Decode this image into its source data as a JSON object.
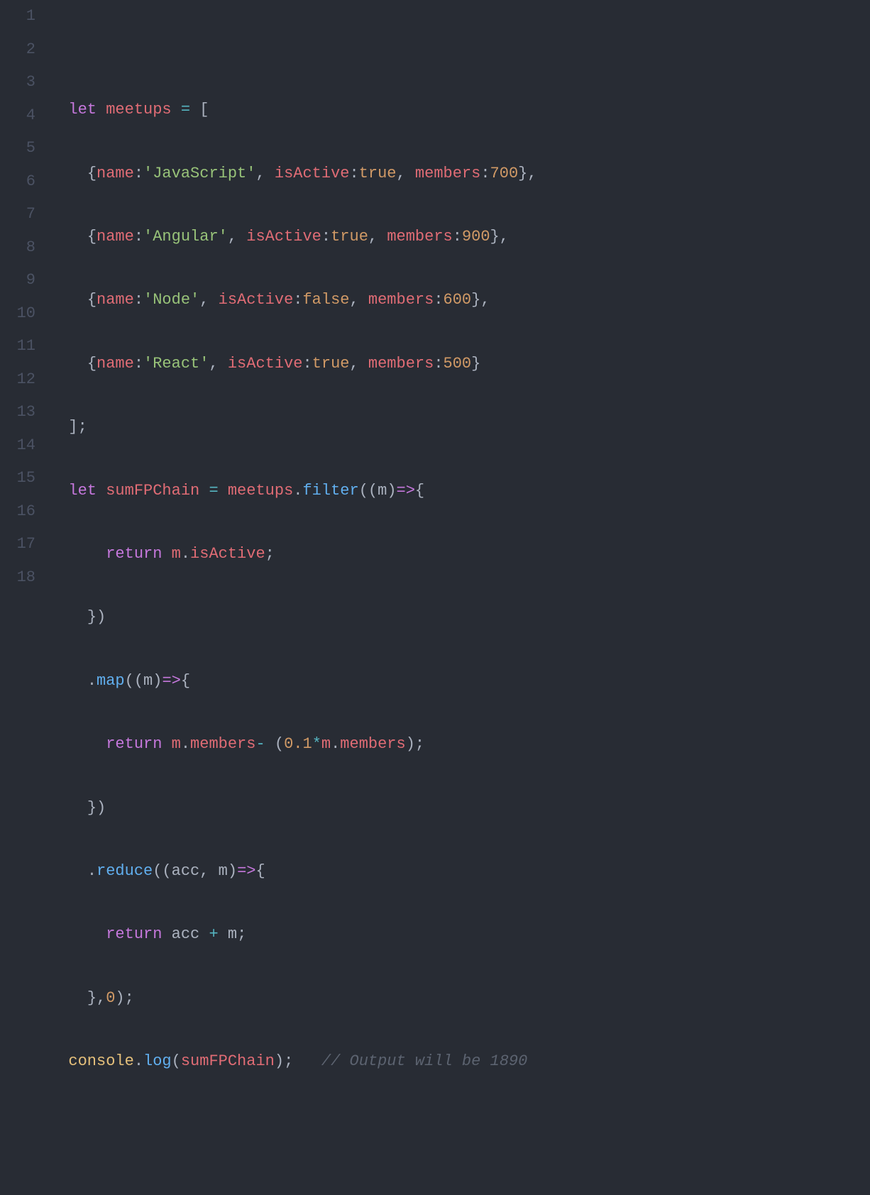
{
  "lineNumbers": [
    "1",
    "2",
    "3",
    "4",
    "5",
    "6",
    "7",
    "8",
    "9",
    "10",
    "11",
    "12",
    "13",
    "14",
    "15",
    "16",
    "17",
    "18"
  ],
  "code": {
    "line2": {
      "let": "let",
      "sp1": " ",
      "var": "meetups",
      "sp2": " ",
      "eq": "=",
      "sp3": " ",
      "br": "["
    },
    "line3": {
      "indent": "    ",
      "lb": "{",
      "name_k": "name",
      "colon1": ":",
      "name_v": "'JavaScript'",
      "comma1": ", ",
      "act_k": "isActive",
      "colon2": ":",
      "act_v": "true",
      "comma2": ", ",
      "mem_k": "members",
      "colon3": ":",
      "mem_v": "700",
      "rb": "},"
    },
    "line4": {
      "indent": "    ",
      "lb": "{",
      "name_k": "name",
      "colon1": ":",
      "name_v": "'Angular'",
      "comma1": ", ",
      "act_k": "isActive",
      "colon2": ":",
      "act_v": "true",
      "comma2": ", ",
      "mem_k": "members",
      "colon3": ":",
      "mem_v": "900",
      "rb": "},"
    },
    "line5": {
      "indent": "    ",
      "lb": "{",
      "name_k": "name",
      "colon1": ":",
      "name_v": "'Node'",
      "comma1": ", ",
      "act_k": "isActive",
      "colon2": ":",
      "act_v": "false",
      "comma2": ", ",
      "mem_k": "members",
      "colon3": ":",
      "mem_v": "600",
      "rb": "},"
    },
    "line6": {
      "indent": "    ",
      "lb": "{",
      "name_k": "name",
      "colon1": ":",
      "name_v": "'React'",
      "comma1": ", ",
      "act_k": "isActive",
      "colon2": ":",
      "act_v": "true",
      "comma2": ", ",
      "mem_k": "members",
      "colon3": ":",
      "mem_v": "500",
      "rb": "}"
    },
    "line7": {
      "close": "];"
    },
    "line8": {
      "let": "let",
      "sp1": " ",
      "var": "sumFPChain",
      "sp2": " ",
      "eq": "=",
      "sp3": " ",
      "obj": "meetups",
      "dot": ".",
      "fn": "filter",
      "open": "((",
      "p": "m",
      "close": ")",
      "arrow": "=>",
      "brace": "{"
    },
    "line9": {
      "indent": "      ",
      "ret": "return",
      "sp": " ",
      "obj": "m",
      "dot": ".",
      "prop": "isActive",
      "semi": ";"
    },
    "line10": {
      "indent": "    ",
      "close": "})"
    },
    "line11": {
      "indent": "    ",
      "dot": ".",
      "fn": "map",
      "open": "((",
      "p": "m",
      "close": ")",
      "arrow": "=>",
      "brace": "{"
    },
    "line12": {
      "indent": "      ",
      "ret": "return",
      "sp": " ",
      "obj1": "m",
      "dot1": ".",
      "prop1": "members",
      "minus": "-",
      "sp2": " (",
      "num": "0.1",
      "star": "*",
      "obj2": "m",
      "dot2": ".",
      "prop2": "members",
      "close": ");"
    },
    "line13": {
      "indent": "    ",
      "close": "})"
    },
    "line14": {
      "indent": "    ",
      "dot": ".",
      "fn": "reduce",
      "open": "((",
      "p1": "acc",
      "comma": ", ",
      "p2": "m",
      "close": ")",
      "arrow": "=>",
      "brace": "{"
    },
    "line15": {
      "indent": "      ",
      "ret": "return",
      "sp": " ",
      "v1": "acc",
      "sp2": " ",
      "plus": "+",
      "sp3": " ",
      "v2": "m",
      "semi": ";"
    },
    "line16": {
      "indent": "    ",
      "close": "},",
      "num": "0",
      "end": ");"
    },
    "line17": {
      "console": "console",
      "dot": ".",
      "fn": "log",
      "open": "(",
      "arg": "sumFPChain",
      "close": ");",
      "sp": "   ",
      "comment": "// Output will be 1890"
    }
  }
}
